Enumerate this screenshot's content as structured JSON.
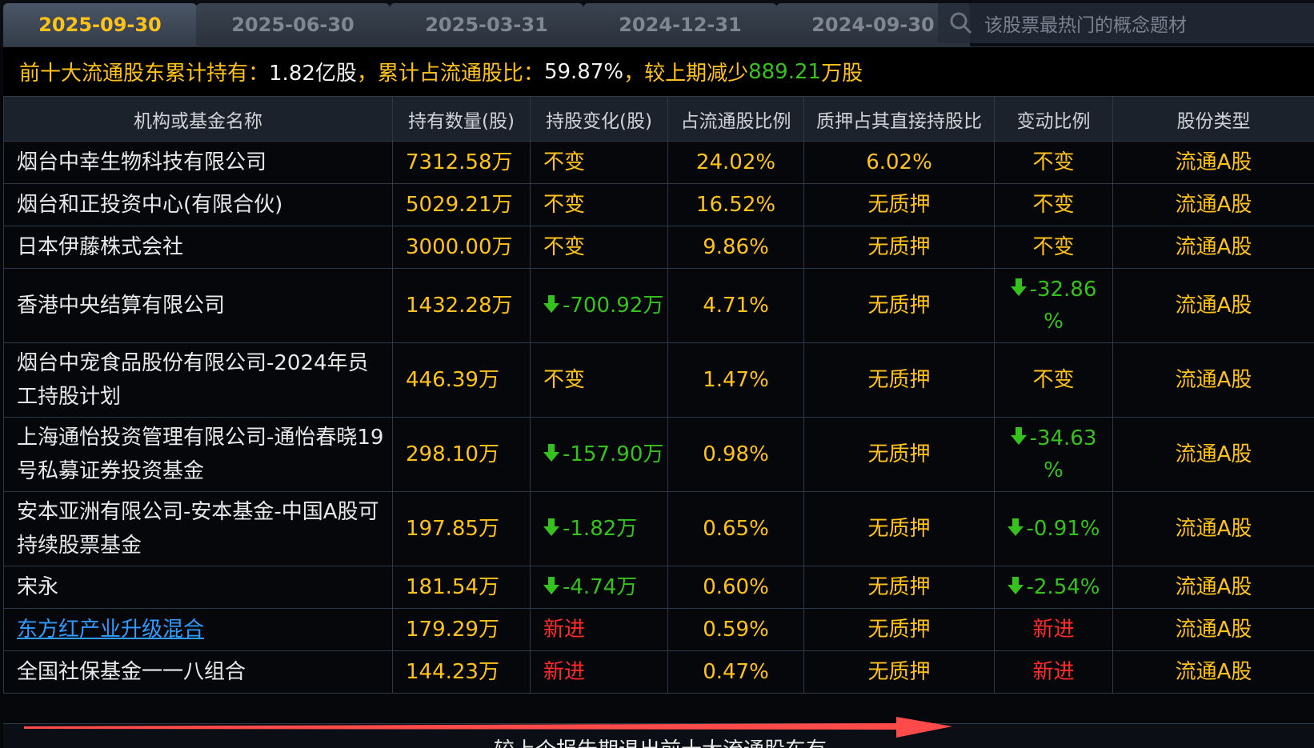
{
  "tabs": [
    "2025-09-30",
    "2025-06-30",
    "2025-03-31",
    "2024-12-31",
    "2024-09-30"
  ],
  "search": {
    "placeholder": "该股票最热门的概念题材"
  },
  "summary": {
    "label1": "前十大流通股东累计持有：",
    "total": "1.82亿股",
    "label2": "，累计占流通股比：",
    "ratio": "59.87%",
    "label3": " ，较上期减少",
    "decrease": "889.21",
    "unit": "万股"
  },
  "table": {
    "columns": [
      "机构或基金名称",
      "持有数量(股)",
      "持股变化(股)",
      "占流通股比例",
      "质押占其直接持股比",
      "变动比例",
      "股份类型"
    ],
    "rows": [
      {
        "name": "烟台中幸生物科技有限公司",
        "shares": "7312.58万",
        "change": "不变",
        "change_type": "nochg",
        "ratio": "24.02%",
        "pledge": "6.02%",
        "change_ratio": "不变",
        "ratio_type": "nochg",
        "share_type": "流通A股"
      },
      {
        "name": "烟台和正投资中心(有限合伙)",
        "shares": "5029.21万",
        "change": "不变",
        "change_type": "nochg",
        "ratio": "16.52%",
        "pledge": "无质押",
        "change_ratio": "不变",
        "ratio_type": "nochg",
        "share_type": "流通A股"
      },
      {
        "name": "日本伊藤株式会社",
        "shares": "3000.00万",
        "change": "不变",
        "change_type": "nochg",
        "ratio": "9.86%",
        "pledge": "无质押",
        "change_ratio": "不变",
        "ratio_type": "nochg",
        "share_type": "流通A股"
      },
      {
        "name": "香港中央结算有限公司",
        "shares": "1432.28万",
        "change": "-700.92万",
        "change_type": "down",
        "ratio": "4.71%",
        "pledge": "无质押",
        "change_ratio": "-32.86",
        "change_ratio_suffix": "%",
        "ratio_type": "down",
        "share_type": "流通A股"
      },
      {
        "name": "烟台中宠食品股份有限公司-2024年员工持股计划",
        "shares": "446.39万",
        "change": "不变",
        "change_type": "nochg",
        "ratio": "1.47%",
        "pledge": "无质押",
        "change_ratio": "不变",
        "ratio_type": "nochg",
        "share_type": "流通A股"
      },
      {
        "name": "上海通怡投资管理有限公司-通怡春晓19号私募证券投资基金",
        "shares": "298.10万",
        "change": "-157.90万",
        "change_type": "down",
        "ratio": "0.98%",
        "pledge": "无质押",
        "change_ratio": "-34.63",
        "change_ratio_suffix": "%",
        "ratio_type": "down",
        "share_type": "流通A股"
      },
      {
        "name": "安本亚洲有限公司-安本基金-中国A股可持续股票基金",
        "shares": "197.85万",
        "change": "-1.82万",
        "change_type": "down",
        "ratio": "0.65%",
        "pledge": "无质押",
        "change_ratio": "-0.91%",
        "ratio_type": "down",
        "share_type": "流通A股"
      },
      {
        "name": "宋永",
        "shares": "181.54万",
        "change": "-4.74万",
        "change_type": "down",
        "ratio": "0.60%",
        "pledge": "无质押",
        "change_ratio": "-2.54%",
        "ratio_type": "down",
        "share_type": "流通A股"
      },
      {
        "name": "东方红产业升级混合",
        "name_link": true,
        "shares": "179.29万",
        "change": "新进",
        "change_type": "new",
        "ratio": "0.59%",
        "pledge": "无质押",
        "change_ratio": "新进",
        "ratio_type": "new",
        "share_type": "流通A股"
      },
      {
        "name": "全国社保基金一一八组合",
        "shares": "144.23万",
        "change": "新进",
        "change_type": "new",
        "ratio": "0.47%",
        "pledge": "无质押",
        "change_ratio": "新进",
        "ratio_type": "new",
        "share_type": "流通A股"
      }
    ]
  },
  "footer": {
    "text": "较上个报告期退出前十大流通股东有"
  },
  "colors": {
    "accent": "#ffc21a",
    "down": "#36c21c",
    "new": "#ff2a2a",
    "link": "#2f9bff",
    "arrow": "#ff4a4a"
  },
  "icons": {
    "search": "search-icon",
    "down": "down-arrow-icon"
  }
}
